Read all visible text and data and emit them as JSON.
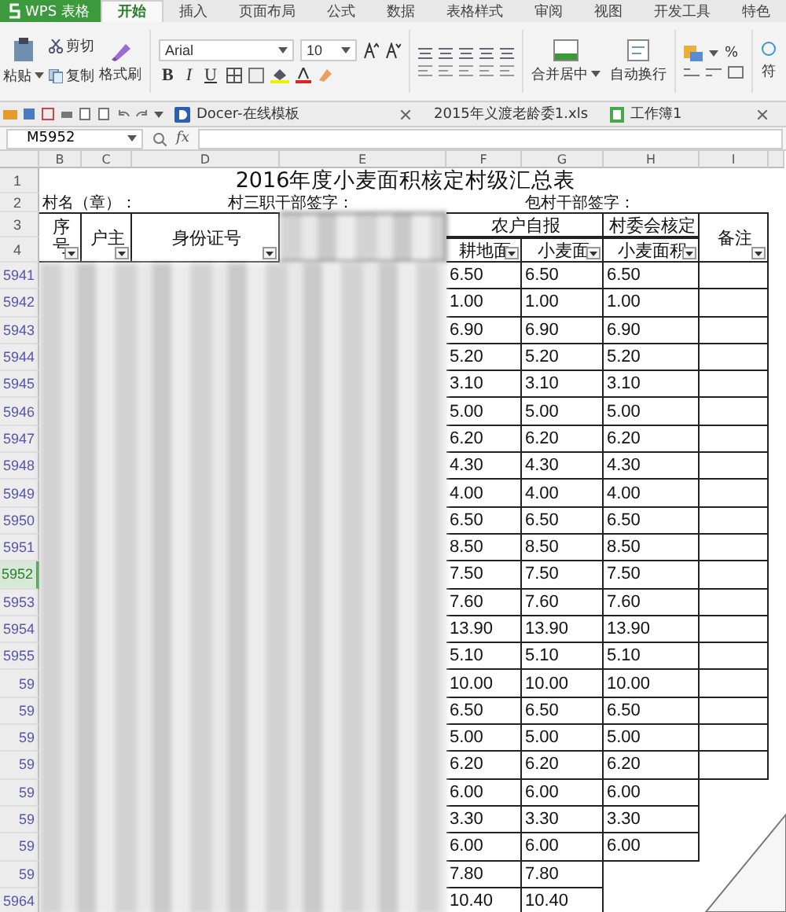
{
  "app": {
    "title": "WPS 表格"
  },
  "ribbon_tabs": [
    {
      "label": "开始",
      "selected": true
    },
    {
      "label": "插入",
      "selected": false
    },
    {
      "label": "页面布局",
      "selected": false
    },
    {
      "label": "公式",
      "selected": false
    },
    {
      "label": "数据",
      "selected": false
    },
    {
      "label": "表格样式",
      "selected": false
    },
    {
      "label": "审阅",
      "selected": false
    },
    {
      "label": "视图",
      "selected": false
    },
    {
      "label": "开发工具",
      "selected": false
    },
    {
      "label": "特色",
      "selected": false
    }
  ],
  "ribbon": {
    "paste": "粘贴",
    "cut": "剪切",
    "copy": "复制",
    "format_painter": "格式刷",
    "font_name": "Arial",
    "font_size": "10",
    "bold": "B",
    "italic": "I",
    "underline": "U",
    "merge": "合并居中",
    "wrap": "自动换行",
    "percent": "%",
    "clipped": "符"
  },
  "doc_tabs": [
    {
      "label": "Docer-在线模板",
      "kind": "docer"
    },
    {
      "label": "2015年义渡老龄委1.xls",
      "kind": "sheet"
    },
    {
      "label": "工作簿1",
      "kind": "sheet"
    }
  ],
  "formula_bar": {
    "cell_ref": "M5952",
    "fx": "fx"
  },
  "column_headers": [
    "B",
    "C",
    "D",
    "E",
    "F",
    "G",
    "H",
    "I"
  ],
  "sheet": {
    "title": "2016年度小麦面积核定村级汇总表",
    "header_rows": [
      "1",
      "2",
      "3",
      "4"
    ],
    "village": "村名（章）：",
    "cadre_sign": "村三职干部签字：",
    "liaison_sign": "包村干部签字：",
    "col_seq": "序号",
    "col_owner": "户主",
    "col_id": "身份证号",
    "group_self": "农户自报",
    "col_farmland": "耕地面",
    "col_wheat_self": "小麦面",
    "group_committee": "村委会核定",
    "col_wheat_checked": "小麦面积",
    "col_note": "备注"
  },
  "rows": [
    {
      "number": "5941",
      "selected": false,
      "values": [
        "6.50",
        "6.50",
        "6.50"
      ]
    },
    {
      "number": "5942",
      "selected": false,
      "values": [
        "1.00",
        "1.00",
        "1.00"
      ]
    },
    {
      "number": "5943",
      "selected": false,
      "values": [
        "6.90",
        "6.90",
        "6.90"
      ]
    },
    {
      "number": "5944",
      "selected": false,
      "values": [
        "5.20",
        "5.20",
        "5.20"
      ]
    },
    {
      "number": "5945",
      "selected": false,
      "values": [
        "3.10",
        "3.10",
        "3.10"
      ]
    },
    {
      "number": "5946",
      "selected": false,
      "values": [
        "5.00",
        "5.00",
        "5.00"
      ]
    },
    {
      "number": "5947",
      "selected": false,
      "values": [
        "6.20",
        "6.20",
        "6.20"
      ]
    },
    {
      "number": "5948",
      "selected": false,
      "values": [
        "4.30",
        "4.30",
        "4.30"
      ]
    },
    {
      "number": "5949",
      "selected": false,
      "values": [
        "4.00",
        "4.00",
        "4.00"
      ]
    },
    {
      "number": "5950",
      "selected": false,
      "values": [
        "6.50",
        "6.50",
        "6.50"
      ]
    },
    {
      "number": "5951",
      "selected": false,
      "values": [
        "8.50",
        "8.50",
        "8.50"
      ]
    },
    {
      "number": "5952",
      "selected": true,
      "values": [
        "7.50",
        "7.50",
        "7.50"
      ]
    },
    {
      "number": "5953",
      "selected": false,
      "values": [
        "7.60",
        "7.60",
        "7.60"
      ]
    },
    {
      "number": "5954",
      "selected": false,
      "values": [
        "13.90",
        "13.90",
        "13.90"
      ]
    },
    {
      "number": "5955",
      "selected": false,
      "values": [
        "5.10",
        "5.10",
        "5.10"
      ]
    },
    {
      "number": "59",
      "selected": false,
      "values": [
        "10.00",
        "10.00",
        "10.00"
      ]
    },
    {
      "number": "59",
      "selected": false,
      "values": [
        "6.50",
        "6.50",
        "6.50"
      ]
    },
    {
      "number": "59",
      "selected": false,
      "values": [
        "5.00",
        "5.00",
        "5.00"
      ]
    },
    {
      "number": "59",
      "selected": false,
      "values": [
        "6.20",
        "6.20",
        "6.20"
      ]
    },
    {
      "number": "59",
      "selected": false,
      "values": [
        "6.00",
        "6.00",
        "6.00"
      ]
    },
    {
      "number": "59",
      "selected": false,
      "values": [
        "3.30",
        "3.30",
        "3.30"
      ]
    },
    {
      "number": "59",
      "selected": false,
      "values": [
        "6.00",
        "6.00",
        "6.00"
      ]
    },
    {
      "number": "59",
      "selected": false,
      "values": [
        "7.80",
        "7.80"
      ]
    },
    {
      "number": "5964",
      "selected": false,
      "values": [
        "10.40",
        "10.40"
      ]
    }
  ]
}
